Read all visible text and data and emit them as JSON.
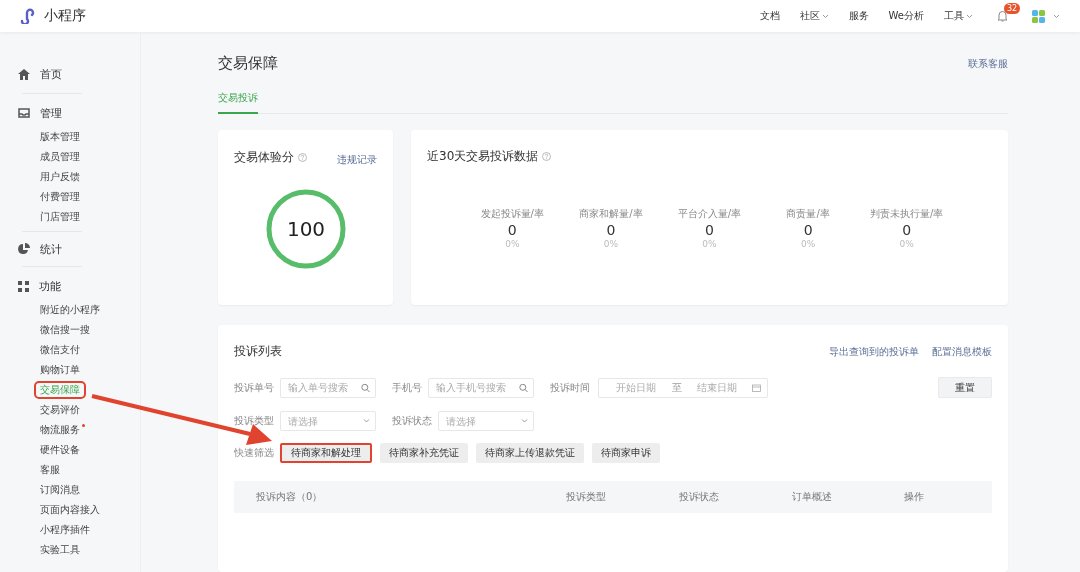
{
  "header": {
    "logo": "小程序",
    "nav": [
      {
        "label": "文档",
        "dropdown": false
      },
      {
        "label": "社区",
        "dropdown": true
      },
      {
        "label": "服务",
        "dropdown": false
      },
      {
        "label": "We分析",
        "dropdown": false
      },
      {
        "label": "工具",
        "dropdown": true
      }
    ],
    "notification_count": "32"
  },
  "sidebar": {
    "groups": [
      {
        "label": "首页"
      },
      {
        "label": "管理",
        "items": [
          {
            "label": "版本管理",
            "selected": false,
            "outlined": false,
            "dot": false
          },
          {
            "label": "成员管理",
            "selected": false,
            "outlined": false,
            "dot": false
          },
          {
            "label": "用户反馈",
            "selected": false,
            "outlined": false,
            "dot": false
          },
          {
            "label": "付费管理",
            "selected": false,
            "outlined": false,
            "dot": false
          },
          {
            "label": "门店管理",
            "selected": false,
            "outlined": false,
            "dot": false
          }
        ]
      },
      {
        "label": "统计"
      },
      {
        "label": "功能",
        "items": [
          {
            "label": "附近的小程序",
            "selected": false,
            "outlined": false,
            "dot": false
          },
          {
            "label": "微信搜一搜",
            "selected": false,
            "outlined": false,
            "dot": false
          },
          {
            "label": "微信支付",
            "selected": false,
            "outlined": false,
            "dot": false
          },
          {
            "label": "购物订单",
            "selected": false,
            "outlined": false,
            "dot": false
          },
          {
            "label": "交易保障",
            "selected": true,
            "outlined": true,
            "dot": false
          },
          {
            "label": "交易评价",
            "selected": false,
            "outlined": false,
            "dot": false
          },
          {
            "label": "物流服务",
            "selected": false,
            "outlined": false,
            "dot": true
          },
          {
            "label": "硬件设备",
            "selected": false,
            "outlined": false,
            "dot": false
          },
          {
            "label": "客服",
            "selected": false,
            "outlined": false,
            "dot": false
          },
          {
            "label": "订阅消息",
            "selected": false,
            "outlined": false,
            "dot": false
          },
          {
            "label": "页面内容接入",
            "selected": false,
            "outlined": false,
            "dot": false
          },
          {
            "label": "小程序插件",
            "selected": false,
            "outlined": false,
            "dot": false
          },
          {
            "label": "实验工具",
            "selected": false,
            "outlined": false,
            "dot": false
          }
        ]
      }
    ]
  },
  "page": {
    "title": "交易保障",
    "contact_link": "联系客服",
    "tabs": [
      {
        "label": "交易投诉",
        "selected": true
      }
    ]
  },
  "score_card": {
    "title": "交易体验分",
    "link": "违规记录",
    "score": "100"
  },
  "stats_card": {
    "title": "近30天交易投诉数据",
    "metrics": [
      {
        "label": "发起投诉量/率",
        "value": "0",
        "rate": "0%"
      },
      {
        "label": "商家和解量/率",
        "value": "0",
        "rate": "0%"
      },
      {
        "label": "平台介入量/率",
        "value": "0",
        "rate": "0%"
      },
      {
        "label": "商责量/率",
        "value": "0",
        "rate": "0%"
      },
      {
        "label": "判责未执行量/率",
        "value": "0",
        "rate": "0%"
      }
    ]
  },
  "complaints": {
    "title": "投诉列表",
    "links": [
      "导出查询到的投诉单",
      "配置消息模板"
    ],
    "search_filters": [
      {
        "kind": "search",
        "label": "投诉单号",
        "placeholder": "输入单号搜索"
      },
      {
        "kind": "search",
        "label": "手机号",
        "placeholder": "输入手机号搜索"
      },
      {
        "kind": "date_range",
        "label": "投诉时间",
        "start_placeholder": "开始日期",
        "separator": "至",
        "end_placeholder": "结束日期"
      }
    ],
    "reset_button": "重置",
    "select_filters": [
      {
        "label": "投诉类型",
        "placeholder": "请选择"
      },
      {
        "label": "投诉状态",
        "placeholder": "请选择"
      }
    ],
    "quick_filter": {
      "label": "快速筛选",
      "buttons": [
        {
          "label": "待商家和解处理",
          "outlined": true
        },
        {
          "label": "待商家补充凭证",
          "outlined": false
        },
        {
          "label": "待商家上传退款凭证",
          "outlined": false
        },
        {
          "label": "待商家申诉",
          "outlined": false
        }
      ]
    },
    "table": {
      "columns": [
        "投诉内容（0）",
        "投诉类型",
        "投诉状态",
        "订单概述",
        "操作"
      ]
    }
  }
}
